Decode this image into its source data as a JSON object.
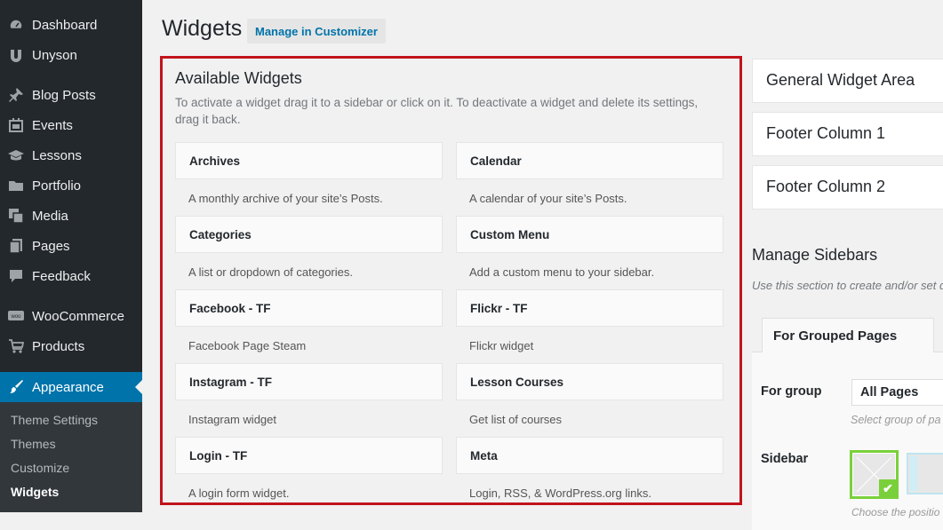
{
  "sidebar": {
    "items": [
      {
        "label": "Dashboard",
        "icon": "dashboard-icon"
      },
      {
        "label": "Unyson",
        "icon": "unyson-icon"
      },
      {
        "label": "Blog Posts",
        "icon": "pin-icon"
      },
      {
        "label": "Events",
        "icon": "calendar-icon"
      },
      {
        "label": "Lessons",
        "icon": "graduation-cap-icon"
      },
      {
        "label": "Portfolio",
        "icon": "folder-icon"
      },
      {
        "label": "Media",
        "icon": "media-icon"
      },
      {
        "label": "Pages",
        "icon": "pages-icon"
      },
      {
        "label": "Feedback",
        "icon": "speech-bubble-icon"
      },
      {
        "label": "WooCommerce",
        "icon": "woocommerce-icon"
      },
      {
        "label": "Products",
        "icon": "cart-icon"
      },
      {
        "label": "Appearance",
        "icon": "brush-icon"
      }
    ],
    "submenu": [
      "Theme Settings",
      "Themes",
      "Customize",
      "Widgets"
    ]
  },
  "header": {
    "title": "Widgets",
    "customizer_button": "Manage in Customizer"
  },
  "available": {
    "title": "Available Widgets",
    "description": "To activate a widget drag it to a sidebar or click on it. To deactivate a widget and delete its settings, drag it back.",
    "widgets": [
      {
        "name": "Archives",
        "desc": "A monthly archive of your site’s Posts."
      },
      {
        "name": "Calendar",
        "desc": "A calendar of your site’s Posts."
      },
      {
        "name": "Categories",
        "desc": "A list or dropdown of categories."
      },
      {
        "name": "Custom Menu",
        "desc": "Add a custom menu to your sidebar."
      },
      {
        "name": "Facebook - TF",
        "desc": "Facebook Page Steam"
      },
      {
        "name": "Flickr - TF",
        "desc": "Flickr widget"
      },
      {
        "name": "Instagram - TF",
        "desc": "Instagram widget"
      },
      {
        "name": "Lesson Courses",
        "desc": "Get list of courses"
      },
      {
        "name": "Login - TF",
        "desc": "A login form widget."
      },
      {
        "name": "Meta",
        "desc": "Login, RSS, & WordPress.org links."
      }
    ]
  },
  "areas": [
    "General Widget Area",
    "Footer Column 1",
    "Footer Column 2"
  ],
  "manage_sidebars": {
    "title": "Manage Sidebars",
    "description": "Use this section to create and/or set d",
    "tab": "For Grouped Pages",
    "group_label": "For group",
    "group_value": "All Pages",
    "group_hint": "Select group of pa",
    "sidebar_label": "Sidebar",
    "position_hint": "Choose the positio"
  },
  "colors": {
    "accent": "#0073aa",
    "highlight_border": "#c1131b",
    "sidebar_bg": "#23282d",
    "selected_green": "#7ad03a"
  }
}
